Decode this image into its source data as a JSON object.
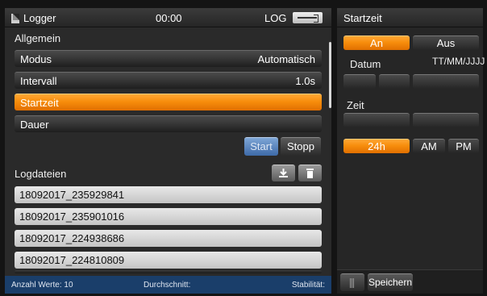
{
  "titlebar": {
    "app_title": "Logger",
    "time": "00:00",
    "log_label": "LOG"
  },
  "general": {
    "section_title": "Allgemein",
    "rows": [
      {
        "label": "Modus",
        "value": "Automatisch"
      },
      {
        "label": "Intervall",
        "value": "1.0s"
      },
      {
        "label": "Startzeit",
        "value": ""
      },
      {
        "label": "Dauer",
        "value": ""
      }
    ],
    "start_label": "Start",
    "stop_label": "Stopp"
  },
  "logfiles": {
    "section_title": "Logdateien",
    "files": [
      "18092017_235929841",
      "18092017_235901016",
      "18092017_224938686",
      "18092017_224810809"
    ]
  },
  "statusbar": {
    "count": "Anzahl Werte: 10",
    "average": "Durchschnitt:",
    "stability": "Stabilität:"
  },
  "right_panel": {
    "title": "Startzeit",
    "on_label": "An",
    "off_label": "Aus",
    "date_label": "Datum",
    "date_format": "TT/MM/JJJJ",
    "time_label": "Zeit",
    "h24_label": "24h",
    "am_label": "AM",
    "pm_label": "PM",
    "save_label": "Speichern"
  },
  "colors": {
    "accent": "#f78d0c",
    "start_button": "#5a82bd",
    "status_bar": "#1a3e6a"
  },
  "icons": {
    "title": "document-icon",
    "usb": "usb-icon",
    "download": "download-icon",
    "delete": "trash-icon",
    "grip": "grip-icon"
  }
}
